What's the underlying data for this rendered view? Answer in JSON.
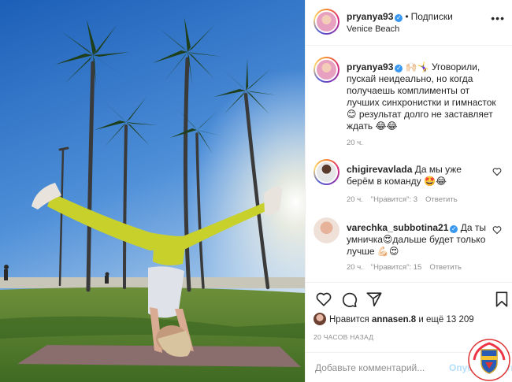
{
  "header": {
    "username": "pryanya93",
    "follow_label": "Подписки",
    "location": "Venice Beach"
  },
  "caption": {
    "username": "pryanya93",
    "emojis": "🙌🏻🤸‍♀️",
    "text": "Уговорили, пускай неидеально, но когда получаешь комплименты от лучших синхронистки и гимнасток😊 результат долго не заставляет ждать 😂😂",
    "time": "20 ч."
  },
  "comments": [
    {
      "username": "chigirevavlada",
      "text": "Да мы уже берём в команду 🤩😂",
      "time": "20 ч.",
      "likes_label": "\"Нравится\": 3",
      "reply_label": "Ответить"
    },
    {
      "username": "varechka_subbotina21",
      "text": "Да ты умничка😍дальше будет только лучше 💪🏻😍",
      "time": "20 ч.",
      "likes_label": "\"Нравится\": 15",
      "reply_label": "Ответить"
    }
  ],
  "likes": {
    "prefix": "Нравится",
    "user": "annasen.8",
    "suffix": "и ещё 13 209"
  },
  "date": "20 ЧАСОВ НАЗАД",
  "add_comment": {
    "placeholder": "Добавьте комментарий...",
    "post_label": "Опубликовать"
  },
  "colors": {
    "verified": "#3897f0",
    "post_disabled": "#b2dffc",
    "muted": "#8e8e8e",
    "text": "#262626"
  }
}
